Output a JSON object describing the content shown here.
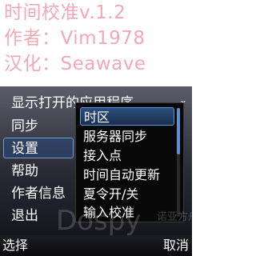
{
  "header": {
    "line1": "时间校准v.1.2",
    "line2": "作者：Vim1978",
    "line3": "汉化：Seawave"
  },
  "menu": {
    "items": [
      {
        "label": "显示打开的应用程序"
      },
      {
        "label": "同步"
      },
      {
        "label": "设置"
      },
      {
        "label": "帮助"
      },
      {
        "label": "作者信息"
      },
      {
        "label": "退出"
      }
    ]
  },
  "submenu": {
    "items": [
      {
        "label": "时区"
      },
      {
        "label": "服务器同步"
      },
      {
        "label": "接入点"
      },
      {
        "label": "时间自动更新"
      },
      {
        "label": "夏令开/关"
      },
      {
        "label": "输入校准"
      }
    ]
  },
  "watermark": {
    "brand": "Dospy",
    "cn": "诺亚方舟"
  },
  "softkeys": {
    "left": "选择",
    "right": "取消"
  }
}
